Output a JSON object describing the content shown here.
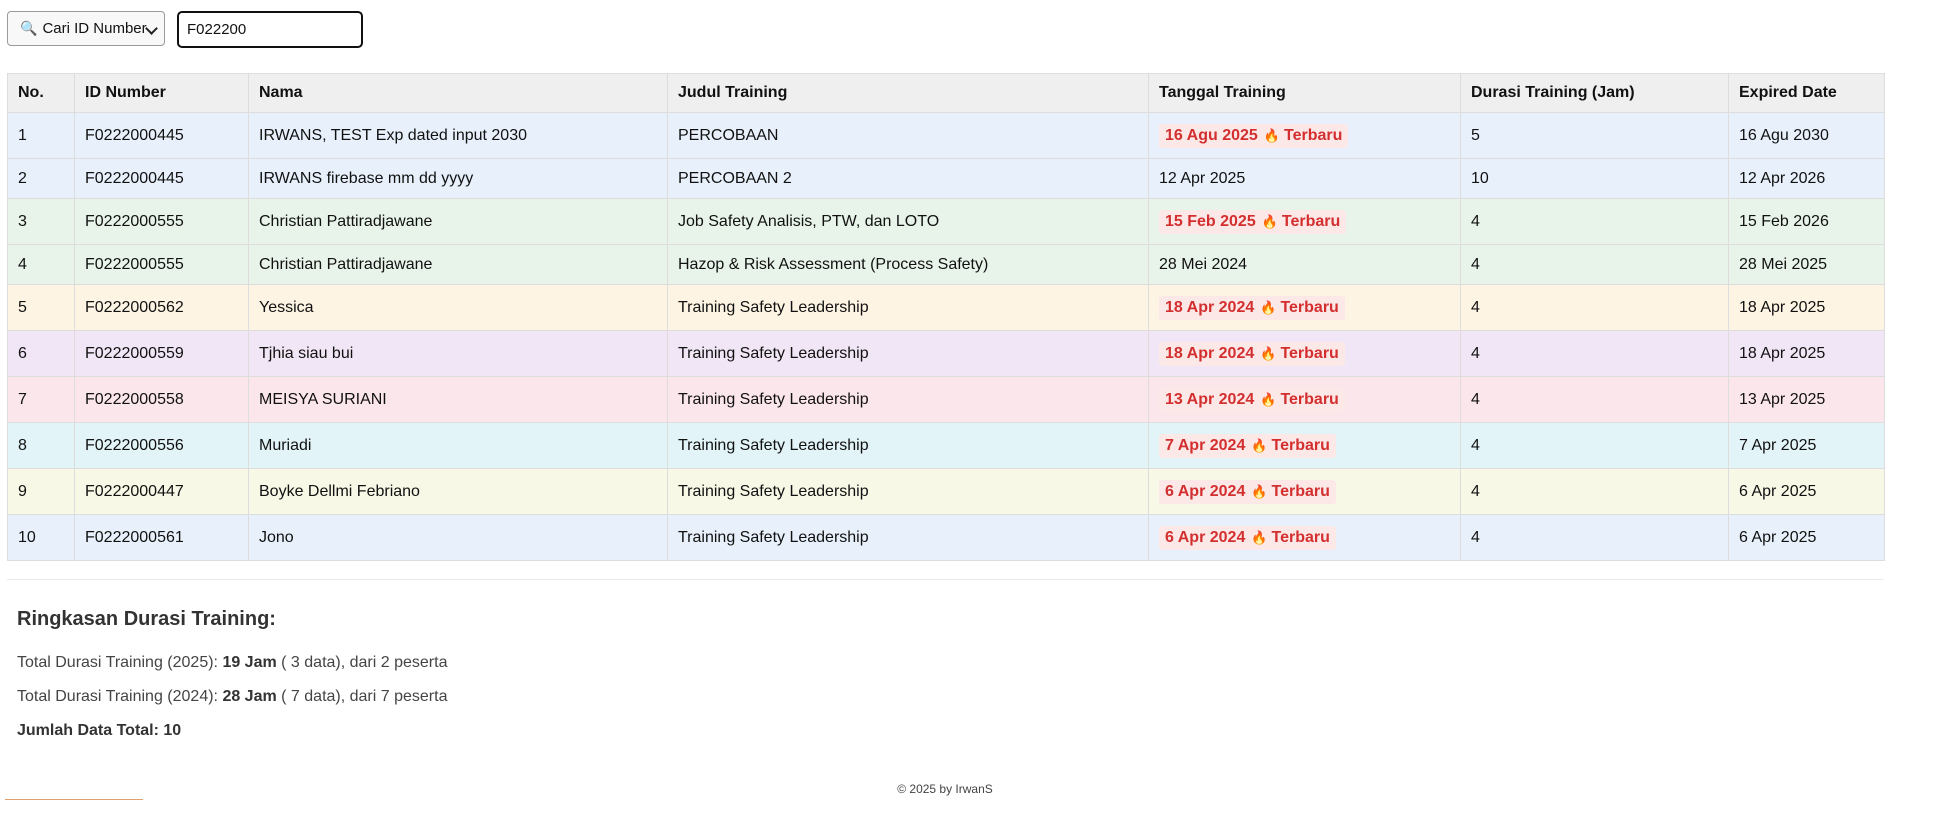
{
  "search": {
    "select_label": "Cari ID Number",
    "input_value": "F022200"
  },
  "table": {
    "headers": [
      "No.",
      "ID Number",
      "Nama",
      "Judul Training",
      "Tanggal Training",
      "Durasi Training (Jam)",
      "Expired Date"
    ],
    "latest_label": "Terbaru",
    "rows": [
      {
        "no": "1",
        "id": "F0222000445",
        "nama": "IRWANS, TEST Exp dated input 2030",
        "judul": "PERCOBAAN",
        "tanggal": "16 Agu 2025",
        "latest": true,
        "durasi": "5",
        "expired": "16 Agu 2030",
        "bg": "#e8f1fb"
      },
      {
        "no": "2",
        "id": "F0222000445",
        "nama": "IRWANS firebase mm dd yyyy",
        "judul": "PERCOBAAN 2",
        "tanggal": "12 Apr 2025",
        "latest": false,
        "durasi": "10",
        "expired": "12 Apr 2026",
        "bg": "#e8f1fb"
      },
      {
        "no": "3",
        "id": "F0222000555",
        "nama": "Christian Pattiradjawane",
        "judul": "Job Safety Analisis, PTW, dan LOTO",
        "tanggal": "15 Feb 2025",
        "latest": true,
        "durasi": "4",
        "expired": "15 Feb 2026",
        "bg": "#e8f4ea"
      },
      {
        "no": "4",
        "id": "F0222000555",
        "nama": "Christian Pattiradjawane",
        "judul": "Hazop & Risk Assessment (Process Safety)",
        "tanggal": "28 Mei 2024",
        "latest": false,
        "durasi": "4",
        "expired": "28 Mei 2025",
        "bg": "#e8f4ea"
      },
      {
        "no": "5",
        "id": "F0222000562",
        "nama": "Yessica",
        "judul": "Training Safety Leadership",
        "tanggal": "18 Apr 2024",
        "latest": true,
        "durasi": "4",
        "expired": "18 Apr 2025",
        "bg": "#fdf4e3"
      },
      {
        "no": "6",
        "id": "F0222000559",
        "nama": "Tjhia siau bui",
        "judul": "Training Safety Leadership",
        "tanggal": "18 Apr 2024",
        "latest": true,
        "durasi": "4",
        "expired": "18 Apr 2025",
        "bg": "#f1e6f5"
      },
      {
        "no": "7",
        "id": "F0222000558",
        "nama": "MEISYA SURIANI",
        "judul": "Training Safety Leadership",
        "tanggal": "13 Apr 2024",
        "latest": true,
        "durasi": "4",
        "expired": "13 Apr 2025",
        "bg": "#fbe6ec"
      },
      {
        "no": "8",
        "id": "F0222000556",
        "nama": "Muriadi",
        "judul": "Training Safety Leadership",
        "tanggal": "7 Apr 2024",
        "latest": true,
        "durasi": "4",
        "expired": "7 Apr 2025",
        "bg": "#e2f4f7"
      },
      {
        "no": "9",
        "id": "F0222000447",
        "nama": "Boyke Dellmi Febriano",
        "judul": "Training Safety Leadership",
        "tanggal": "6 Apr 2024",
        "latest": true,
        "durasi": "4",
        "expired": "6 Apr 2025",
        "bg": "#f7f8e6"
      },
      {
        "no": "10",
        "id": "F0222000561",
        "nama": "Jono",
        "judul": "Training Safety Leadership",
        "tanggal": "6 Apr 2024",
        "latest": true,
        "durasi": "4",
        "expired": "6 Apr 2025",
        "bg": "#e8f1fb"
      }
    ]
  },
  "summary": {
    "title": "Ringkasan Durasi Training:",
    "lines": [
      {
        "prefix": "Total Durasi Training (2025): ",
        "hours": "19 Jam",
        "suffix": " ( 3 data), dari 2 peserta"
      },
      {
        "prefix": "Total Durasi Training (2024): ",
        "hours": "28 Jam",
        "suffix": " ( 7 data), dari 7 peserta"
      }
    ],
    "total": "Jumlah Data Total: 10"
  },
  "footer": {
    "text": "© 2025 by IrwanS"
  }
}
